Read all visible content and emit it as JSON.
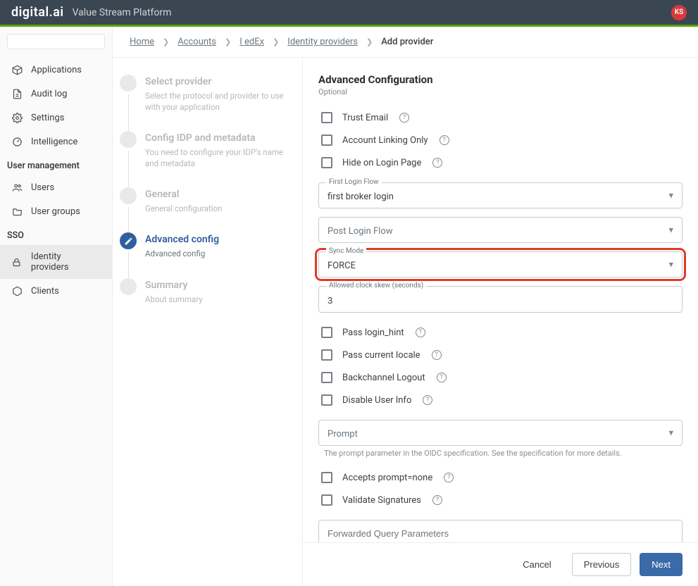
{
  "header": {
    "brand": "digital.ai",
    "platform": "Value Stream Platform",
    "avatar_initials": "KS"
  },
  "sidebar": {
    "items": [
      {
        "label": "Applications"
      },
      {
        "label": "Audit log"
      },
      {
        "label": "Settings"
      },
      {
        "label": "Intelligence"
      }
    ],
    "section_user_mgmt": "User management",
    "user_mgmt_items": [
      {
        "label": "Users"
      },
      {
        "label": "User groups"
      }
    ],
    "section_sso": "SSO",
    "sso_items": [
      {
        "label": "Identity providers",
        "active": true
      },
      {
        "label": "Clients"
      }
    ]
  },
  "breadcrumbs": {
    "items": [
      "Home",
      "Accounts",
      "I edEx",
      "Identity providers"
    ],
    "current": "Add provider"
  },
  "steps": [
    {
      "title": "Select provider",
      "desc": "Select the protocol and provider to use with your application"
    },
    {
      "title": "Config IDP and metadata",
      "desc": "You need to configure your IDP's name and metadata"
    },
    {
      "title": "General",
      "desc": "General configuration"
    },
    {
      "title": "Advanced config",
      "desc": "Advanced config",
      "active": true
    },
    {
      "title": "Summary",
      "desc": "About summary"
    }
  ],
  "form": {
    "title": "Advanced Configuration",
    "subtitle": "Optional",
    "checks": {
      "trust_email": "Trust Email",
      "account_linking": "Account Linking Only",
      "hide_login": "Hide on Login Page",
      "pass_login_hint": "Pass login_hint",
      "pass_locale": "Pass current locale",
      "backchannel_logout": "Backchannel Logout",
      "disable_user_info": "Disable User Info",
      "accepts_prompt_none": "Accepts prompt=none",
      "validate_signatures": "Validate Signatures"
    },
    "first_login_flow": {
      "label": "First Login Flow",
      "value": "first broker login"
    },
    "post_login_flow": {
      "label": "Post Login Flow"
    },
    "sync_mode": {
      "label": "Sync Mode",
      "value": "FORCE"
    },
    "clock_skew": {
      "label": "Allowed clock skew (seconds)",
      "value": "3"
    },
    "prompt": {
      "label": "Prompt",
      "helper": "The prompt parameter in the OIDC specification. See the specification for more details."
    },
    "forwarded_query": {
      "label": "Forwarded Query Parameters"
    }
  },
  "footer": {
    "cancel": "Cancel",
    "previous": "Previous",
    "next": "Next"
  }
}
